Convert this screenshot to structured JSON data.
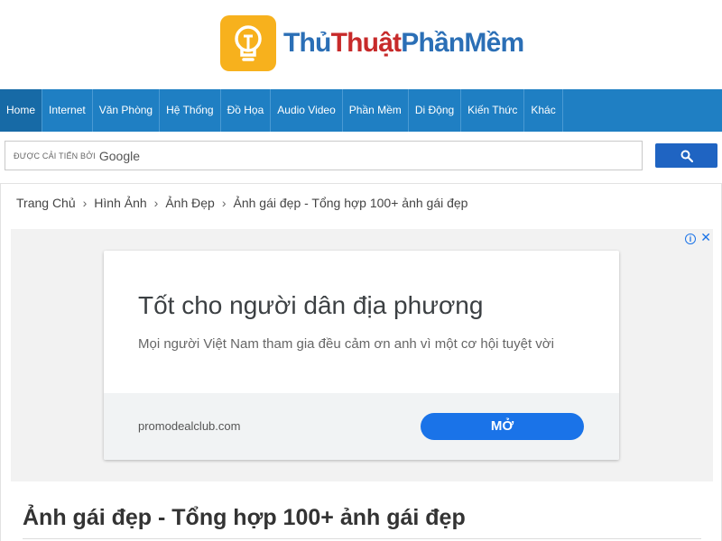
{
  "header": {
    "logo_part1": "Thủ",
    "logo_part2": "Thuật",
    "logo_part3": "PhầnMềm",
    "logo_icon": "lightbulb-icon"
  },
  "nav": {
    "items": [
      {
        "label": "Home",
        "active": true
      },
      {
        "label": "Internet"
      },
      {
        "label": "Văn Phòng"
      },
      {
        "label": "Hệ Thống"
      },
      {
        "label": "Đồ Họa"
      },
      {
        "label": "Audio Video"
      },
      {
        "label": "Phần Mềm"
      },
      {
        "label": "Di Động"
      },
      {
        "label": "Kiến Thức"
      },
      {
        "label": "Khác"
      }
    ]
  },
  "search": {
    "powered_by": "ĐƯỢC CẢI TIẾN BỞI",
    "brand": "Google",
    "button_icon": "search-icon"
  },
  "breadcrumb": {
    "items": [
      "Trang Chủ",
      "Hình Ảnh",
      "Ảnh Đẹp"
    ],
    "separator": "›",
    "current": "Ảnh gái đẹp - Tổng hợp 100+ ảnh gái đẹp"
  },
  "ad": {
    "info_icon": "i",
    "close_icon": "✕",
    "title": "Tốt cho người dân địa phương",
    "description": "Mọi người Việt Nam tham gia đều cảm ơn anh vì một cơ hội tuyệt vời",
    "domain": "promodealclub.com",
    "cta": "MỞ"
  },
  "article": {
    "title": "Ảnh gái đẹp - Tổng hợp 100+ ảnh gái đẹp"
  },
  "colors": {
    "nav_bg": "#1f7fc3",
    "logo_blue": "#2b6fb6",
    "logo_red": "#c72a2a",
    "logo_icon_bg": "#f7b11d",
    "ad_cta": "#1a73e8"
  }
}
